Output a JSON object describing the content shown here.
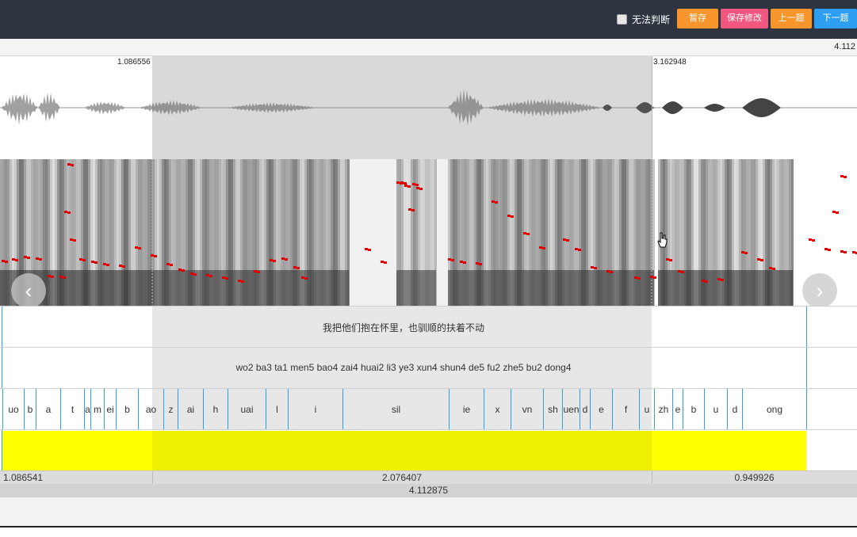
{
  "toolbar": {
    "checkbox_label": "无法判断",
    "save_label": "暂存",
    "save_modify_label": "保存修改",
    "prev_label": "上一题",
    "next_label": "下一题"
  },
  "colors": {
    "topbar": "#2f3441",
    "orange": "#f7962d",
    "pink": "#f2577f",
    "blue": "#2c9ff2",
    "pitch": "#e00000",
    "annotation_fill": "#ffff00"
  },
  "ruler": {
    "total_duration": "4.112"
  },
  "selection": {
    "start": "1.086556",
    "end": "3.162948"
  },
  "sentence": "我把他们抱在怀里，也驯顺的扶着不动",
  "pinyin": "wo2 ba3 ta1 men5 bao4 zai4 huai2 li3 ye3 xun4 shun4 de5 fu2 zhe5 bu2 dong4",
  "phones": [
    "uo",
    "b",
    "a",
    "t",
    "a",
    "m",
    "ei",
    "b",
    "ao",
    "z",
    "ai",
    "h",
    "uai",
    "l",
    "i",
    "sil",
    "ie",
    "x",
    "vn",
    "sh",
    "uen",
    "d",
    "e",
    "f",
    "u",
    "zh",
    "e",
    "b",
    "u",
    "d",
    "ong"
  ],
  "segments": {
    "left": "1.086541",
    "middle": "2.076407",
    "right": "0.949926"
  },
  "total": "4.112875",
  "icons": {
    "prev": "chevron-left-icon",
    "next": "chevron-right-icon",
    "cursor": "hand-cursor-icon"
  }
}
